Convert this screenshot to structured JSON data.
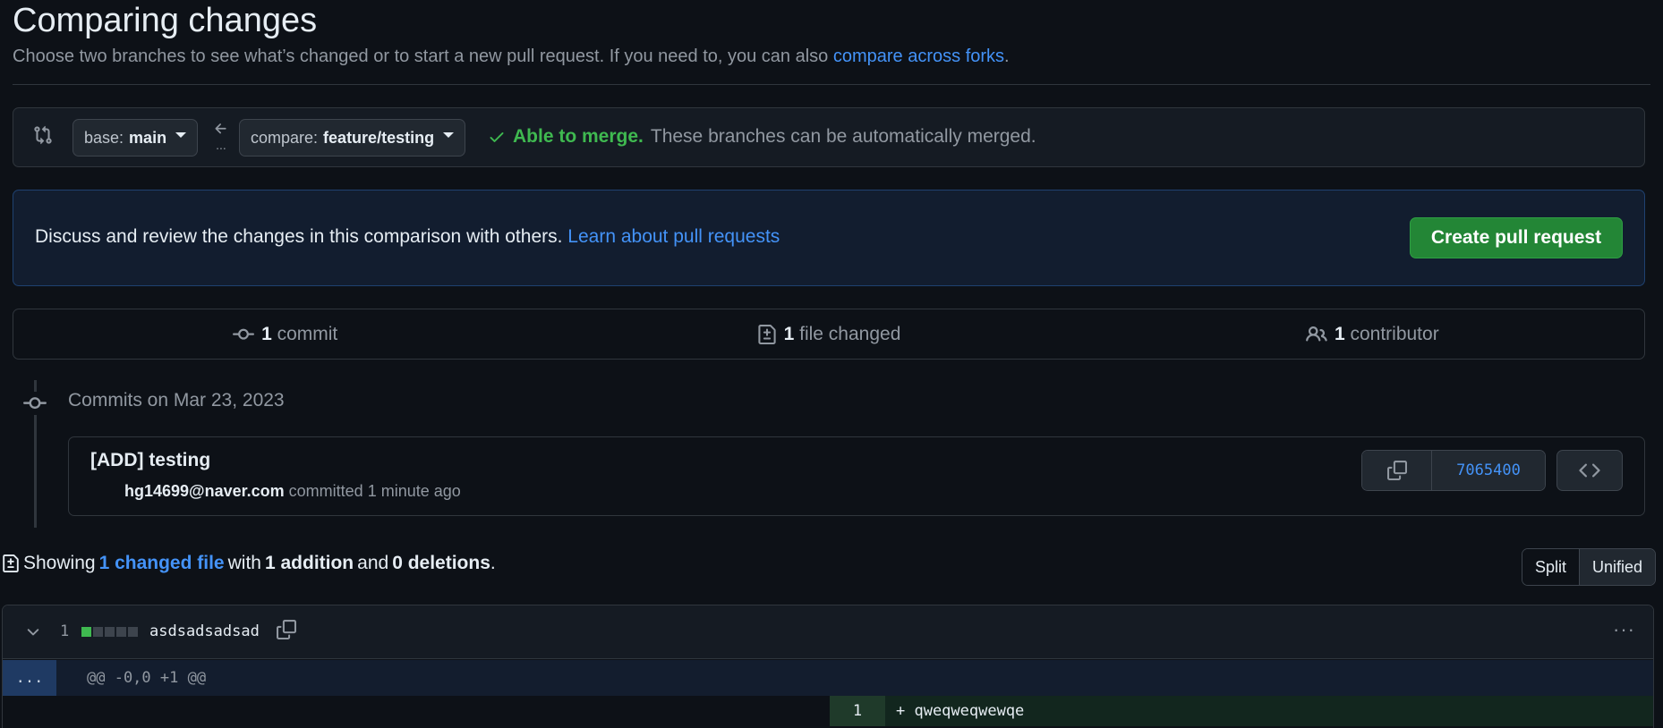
{
  "header": {
    "title": "Comparing changes",
    "description": "Choose two branches to see what’s changed or to start a new pull request. If you need to, you can also ",
    "forks_link": "compare across forks",
    "description_end": "."
  },
  "range": {
    "base_prefix": "base:",
    "base_branch": "main",
    "compare_prefix": "compare:",
    "compare_branch": "feature/testing",
    "merge_ok": "Able to merge.",
    "merge_text": "These branches can be automatically merged."
  },
  "discuss": {
    "text": "Discuss and review the changes in this comparison with others.",
    "link": "Learn about pull requests",
    "button": "Create pull request"
  },
  "summary": {
    "commits_count": "1",
    "commits_label": "commit",
    "files_count": "1",
    "files_label": "file changed",
    "contributors_count": "1",
    "contributors_label": "contributor"
  },
  "commits": {
    "date_heading": "Commits on Mar 23, 2023",
    "title": "[ADD] testing",
    "author": "hg14699@naver.com",
    "meta": "committed 1 minute ago",
    "sha": "7065400"
  },
  "toc": {
    "showing": "Showing",
    "changed_files": "1 changed file",
    "with": "with",
    "additions": "1 addition",
    "and": "and",
    "deletions": "0 deletions",
    "end": "."
  },
  "view_toggle": {
    "split": "Split",
    "unified": "Unified"
  },
  "file": {
    "changes": "1",
    "name": "asdsadsadsad",
    "hunk_expand": "...",
    "hunk_header": "@@ -0,0 +1 @@",
    "line_number": "1",
    "line_code": "+ qweqweqwewqe",
    "diffstat_colors": [
      "#3fb950",
      "#3d444d",
      "#3d444d",
      "#3d444d",
      "#3d444d"
    ],
    "kebab": "···"
  },
  "colors": {
    "accent": "#4493f8",
    "success": "#3fb950",
    "button_green": "#238636"
  }
}
